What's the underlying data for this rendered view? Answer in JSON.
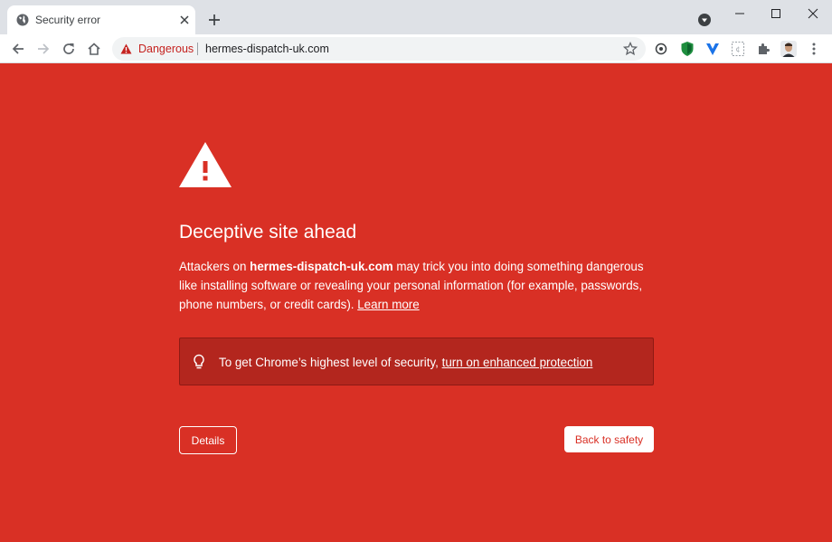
{
  "tab": {
    "title": "Security error",
    "favicon": "globe-icon"
  },
  "window_controls": [
    "minimize-icon",
    "maximize-icon",
    "close-icon"
  ],
  "toolbar": {
    "security_chip_label": "Dangerous",
    "url": "hermes-dispatch-uk.com",
    "extensions": [
      "tracker-blocker-icon",
      "shield-extension-icon",
      "vpn-extension-icon",
      "page-extension-icon",
      "puzzle-icon",
      "profile-avatar"
    ]
  },
  "interstitial": {
    "heading": "Deceptive site ahead",
    "body_prefix": "Attackers on ",
    "body_domain": "hermes-dispatch-uk.com",
    "body_suffix": " may trick you into doing something dangerous like installing software or revealing your personal information (for example, passwords, phone numbers, or credit cards). ",
    "learn_more": "Learn more",
    "promo_text": "To get Chrome’s highest level of security, ",
    "promo_link": "turn on enhanced protection",
    "details_button": "Details",
    "back_button": "Back to safety"
  },
  "colors": {
    "danger_red": "#d93025",
    "promo_red": "#b3261e",
    "tab_strip": "#dee1e6",
    "omnibox_bg": "#f1f3f4"
  }
}
